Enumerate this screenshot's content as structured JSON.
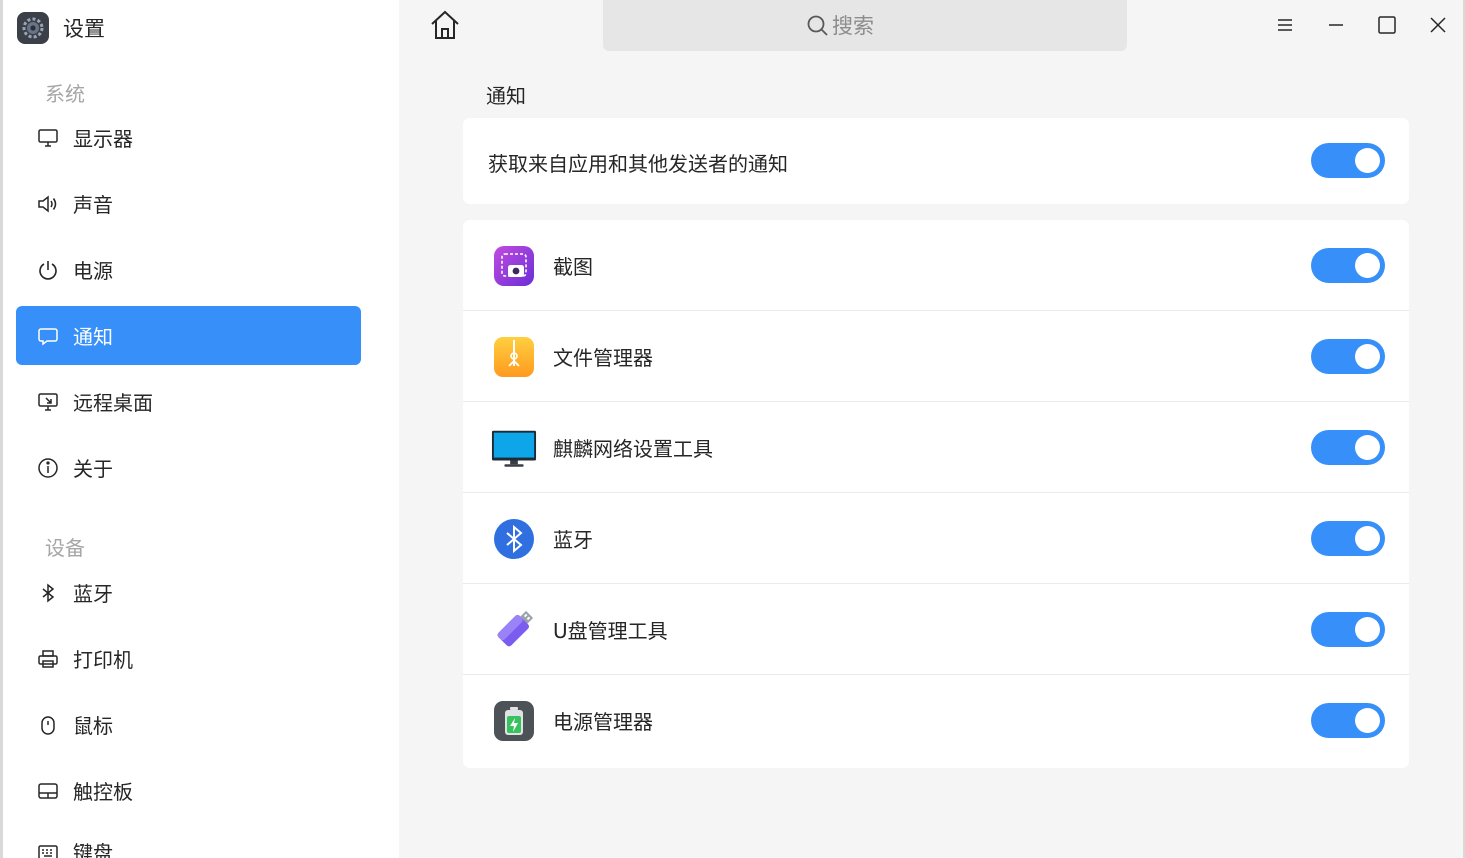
{
  "app": {
    "title": "设置",
    "icon": "settings-gear-icon"
  },
  "search": {
    "placeholder": "搜索"
  },
  "sidebar": {
    "groups": [
      {
        "title": "系统"
      },
      {
        "title": "设备"
      }
    ],
    "items": [
      {
        "label": "显示器",
        "icon": "monitor-icon"
      },
      {
        "label": "声音",
        "icon": "speaker-icon"
      },
      {
        "label": "电源",
        "icon": "power-icon"
      },
      {
        "label": "通知",
        "icon": "chat-bubble-icon",
        "active": true
      },
      {
        "label": "远程桌面",
        "icon": "remote-desktop-icon"
      },
      {
        "label": "关于",
        "icon": "info-icon"
      },
      {
        "label": "蓝牙",
        "icon": "bluetooth-icon"
      },
      {
        "label": "打印机",
        "icon": "printer-icon"
      },
      {
        "label": "鼠标",
        "icon": "mouse-icon"
      },
      {
        "label": "触控板",
        "icon": "touchpad-icon"
      },
      {
        "label": "键盘",
        "icon": "keyboard-icon"
      }
    ]
  },
  "main": {
    "section_title": "通知",
    "master": {
      "label": "获取来自应用和其他发送者的通知",
      "enabled": true
    },
    "apps": [
      {
        "name": "截图",
        "icon": "screenshot-app-icon",
        "enabled": true
      },
      {
        "name": "文件管理器",
        "icon": "file-manager-app-icon",
        "enabled": true
      },
      {
        "name": "麒麟网络设置工具",
        "icon": "network-monitor-app-icon",
        "enabled": true
      },
      {
        "name": "蓝牙",
        "icon": "bluetooth-app-icon",
        "enabled": true
      },
      {
        "name": "U盘管理工具",
        "icon": "usb-drive-app-icon",
        "enabled": true
      },
      {
        "name": "电源管理器",
        "icon": "battery-app-icon",
        "enabled": true
      }
    ]
  },
  "colors": {
    "accent": "#3790fa",
    "sidebar_bg": "#ffffff",
    "content_bg": "#f5f5f5"
  }
}
